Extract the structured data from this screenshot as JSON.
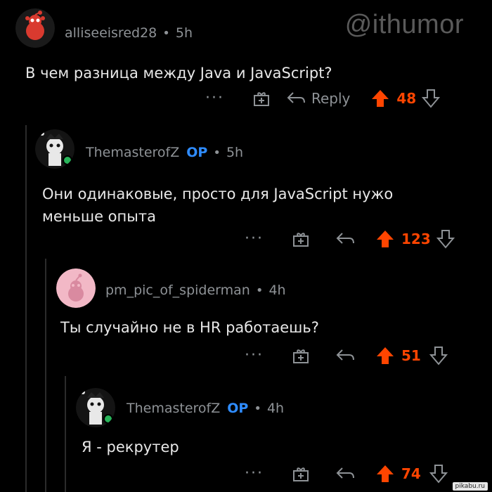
{
  "watermark": "@ithumor",
  "footer_badge": "pikabu.ru",
  "colors": {
    "background": "#000000",
    "upvote": "#ff4500",
    "op": "#2f8cff",
    "muted": "#8e9296"
  },
  "comments": [
    {
      "username": "alliseeisred28",
      "op": "",
      "time": "5h",
      "text": "В чем разница между Java и JavaScript?",
      "reply_label": "Reply",
      "more": "···",
      "score": "48"
    },
    {
      "username": "ThemasterofZ",
      "op": "OP",
      "time": "5h",
      "text": "Они одинаковые, просто для JavaScript нужо меньше опыта",
      "reply_label": "",
      "more": "···",
      "score": "123"
    },
    {
      "username": "pm_pic_of_spiderman",
      "op": "",
      "time": "4h",
      "text": "Ты случайно не в HR работаешь?",
      "reply_label": "",
      "more": "···",
      "score": "51"
    },
    {
      "username": "ThemasterofZ",
      "op": "OP",
      "time": "4h",
      "text": "Я - рекрутер",
      "reply_label": "",
      "more": "···",
      "score": "74"
    }
  ]
}
